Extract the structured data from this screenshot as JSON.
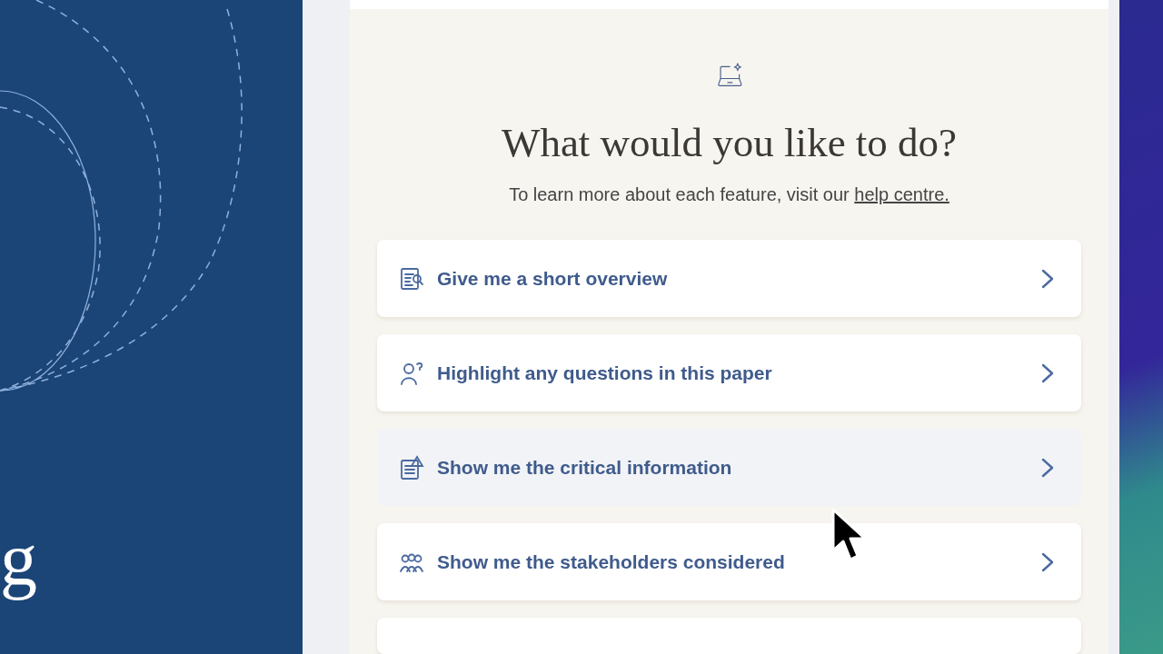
{
  "side_panel": {
    "title_fragment": "g"
  },
  "dialog": {
    "heading": "What would you like to do?",
    "subtitle": "To learn more about each feature, visit our ",
    "help_link": "help centre.",
    "options": [
      {
        "kind": "overview",
        "label": "Give me a short overview",
        "hovered": false
      },
      {
        "kind": "questions",
        "label": "Highlight any questions in this paper",
        "hovered": false
      },
      {
        "kind": "critical",
        "label": "Show me the critical information",
        "hovered": true
      },
      {
        "kind": "stakeholders",
        "label": "Show me the stakeholders considered",
        "hovered": false
      }
    ]
  }
}
